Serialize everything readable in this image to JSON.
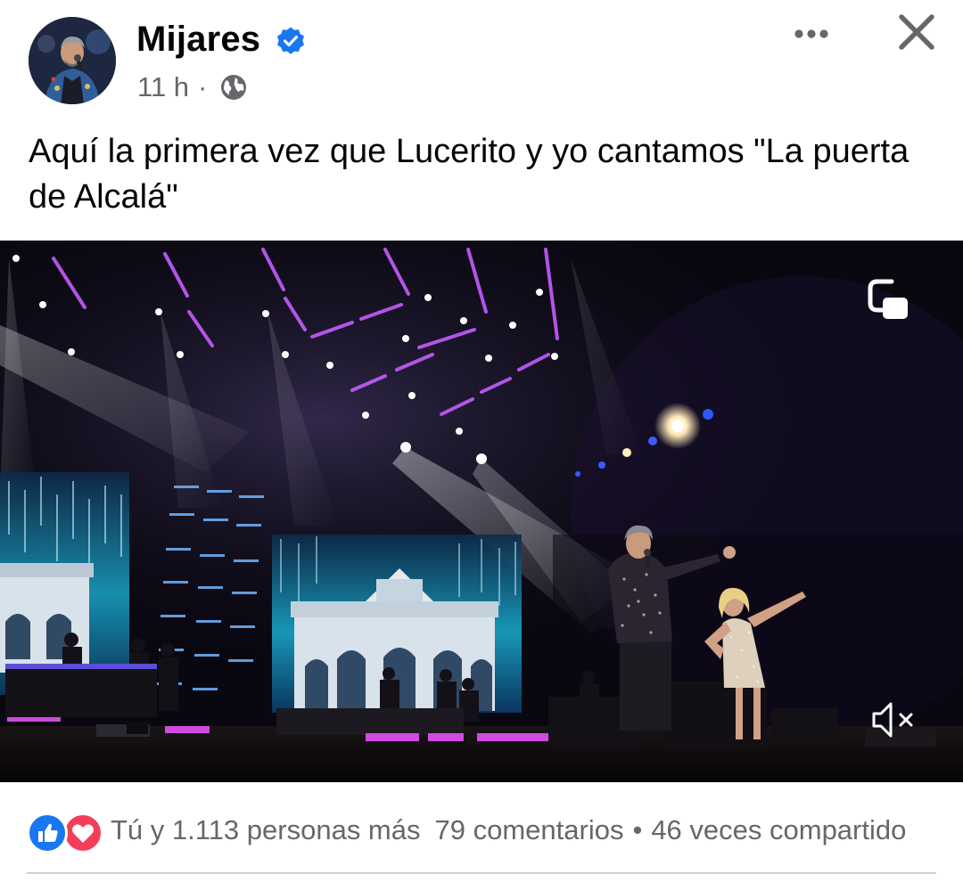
{
  "post": {
    "author": "Mijares",
    "time": "11 h",
    "separator": "·",
    "caption": "Aquí la primera vez que Lucerito y yo cantamos \"La puerta de Alcalá\""
  },
  "icons": {
    "verified": "verified-badge-icon",
    "audience": "globe-icon",
    "more": "more-options-icon",
    "close": "close-icon",
    "pip": "picture-in-picture-icon",
    "mute": "muted-speaker-icon",
    "like": "like-reaction-icon",
    "love": "love-reaction-icon"
  },
  "engagement": {
    "reactions_text": "Tú y 1.113 personas más",
    "comments": "79 comentarios",
    "dot": "•",
    "shares": "46 veces compartido"
  },
  "colors": {
    "facebook_blue": "#1877f2",
    "love_red": "#f33e58",
    "secondary_text": "#65676b",
    "primary_text": "#050505"
  }
}
